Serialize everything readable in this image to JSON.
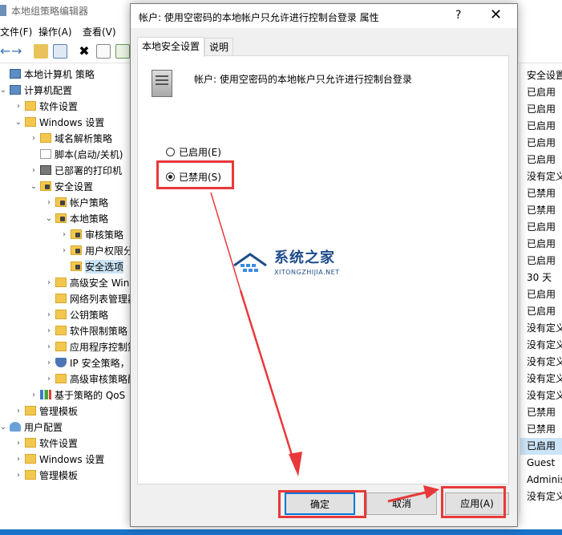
{
  "editor": {
    "title": "本地组策略编辑器",
    "menu": [
      "文件(F)",
      "操作(A)",
      "查看(V)"
    ],
    "tree": [
      {
        "label": "本地计算机 策略",
        "icon": "computer-policy-icon",
        "depth": 0,
        "arrow": ""
      },
      {
        "label": "计算机配置",
        "icon": "computer-icon",
        "depth": 0,
        "arrow": "v"
      },
      {
        "label": "软件设置",
        "icon": "folder-icon",
        "depth": 1,
        "arrow": ">"
      },
      {
        "label": "Windows 设置",
        "icon": "folder-icon",
        "depth": 1,
        "arrow": "v"
      },
      {
        "label": "域名解析策略",
        "icon": "folder-icon",
        "depth": 2,
        "arrow": ">"
      },
      {
        "label": "脚本(启动/关机)",
        "icon": "script-icon",
        "depth": 2,
        "arrow": ""
      },
      {
        "label": "已部署的打印机",
        "icon": "printer-icon",
        "depth": 2,
        "arrow": ">"
      },
      {
        "label": "安全设置",
        "icon": "lock-folder-icon",
        "depth": 2,
        "arrow": "v"
      },
      {
        "label": "帐户策略",
        "icon": "lock-folder-icon",
        "depth": 3,
        "arrow": ">"
      },
      {
        "label": "本地策略",
        "icon": "lock-folder-icon",
        "depth": 3,
        "arrow": "v"
      },
      {
        "label": "审核策略",
        "icon": "lock-folder-icon",
        "depth": 4,
        "arrow": ">"
      },
      {
        "label": "用户权限分",
        "icon": "lock-folder-icon",
        "depth": 4,
        "arrow": ">"
      },
      {
        "label": "安全选项",
        "icon": "lock-folder-icon",
        "depth": 4,
        "arrow": "",
        "selected": true
      },
      {
        "label": "高级安全 Wind",
        "icon": "folder-icon",
        "depth": 3,
        "arrow": ">"
      },
      {
        "label": "网络列表管理器",
        "icon": "folder-icon",
        "depth": 3,
        "arrow": ""
      },
      {
        "label": "公钥策略",
        "icon": "folder-icon",
        "depth": 3,
        "arrow": ">"
      },
      {
        "label": "软件限制策略",
        "icon": "folder-icon",
        "depth": 3,
        "arrow": ">"
      },
      {
        "label": "应用程序控制策",
        "icon": "folder-icon",
        "depth": 3,
        "arrow": ">"
      },
      {
        "label": "IP 安全策略，",
        "icon": "shield-icon",
        "depth": 3,
        "arrow": ">"
      },
      {
        "label": "高级审核策略配",
        "icon": "folder-icon",
        "depth": 3,
        "arrow": ">"
      },
      {
        "label": "基于策略的 QoS",
        "icon": "bar-chart-icon",
        "depth": 2,
        "arrow": ">"
      },
      {
        "label": "管理模板",
        "icon": "folder-icon",
        "depth": 1,
        "arrow": ">"
      },
      {
        "label": "用户配置",
        "icon": "user-icon",
        "depth": 0,
        "arrow": "v"
      },
      {
        "label": "软件设置",
        "icon": "folder-icon",
        "depth": 1,
        "arrow": ">"
      },
      {
        "label": "Windows 设置",
        "icon": "folder-icon",
        "depth": 1,
        "arrow": ">"
      },
      {
        "label": "管理模板",
        "icon": "folder-icon",
        "depth": 1,
        "arrow": ">"
      }
    ],
    "right_column": {
      "header": "安全设置",
      "values": [
        "已启用",
        "已启用",
        "已启用",
        "已启用",
        "已启用",
        "没有定义",
        "已禁用",
        "已禁用",
        "已启用",
        "已启用",
        "已启用",
        "30 天",
        "已启用",
        "已启用",
        "没有定义",
        "没有定义",
        "没有定义",
        "没有定义",
        "没有定义",
        "已禁用",
        "已禁用",
        "已启用",
        "Guest",
        "Administ",
        "没有定义"
      ],
      "selected_index": 21
    }
  },
  "dialog": {
    "title": "帐户: 使用空密码的本地帐户只允许进行控制台登录 属性",
    "help": "?",
    "close": "✕",
    "tabs": [
      "本地安全设置",
      "说明"
    ],
    "policy_name": "帐户: 使用空密码的本地帐户只允许进行控制台登录",
    "option_enabled": "已启用(E)",
    "option_disabled": "已禁用(S)",
    "selected_option": "disabled",
    "buttons": {
      "ok": "确定",
      "cancel": "取消",
      "apply": "应用(A)"
    }
  },
  "watermark": {
    "title": "系统之家",
    "subtitle": "XITONGZHIJIA.NET"
  },
  "colors": {
    "annotation": "#e8393a",
    "selection": "#cce4f7",
    "folder": "#f3c74e",
    "accent": "#0078d7"
  }
}
